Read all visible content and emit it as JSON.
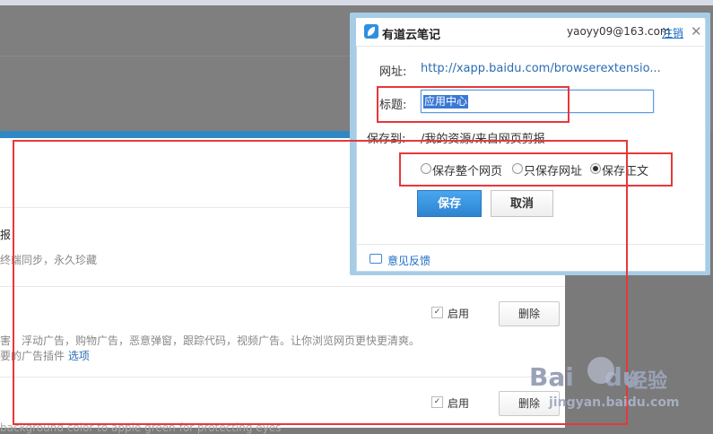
{
  "background_page": {
    "item1": {
      "title_fragment": "报",
      "desc_fragment": "终端同步，永久珍藏"
    },
    "item2": {
      "desc_line1": "害：浮动广告，购物广告，恶意弹窗，跟踪代码，视频广告。让你浏览网页更快更清爽。",
      "desc_line2": "要的广告插件",
      "options_link": "选项",
      "enable_label": "启用",
      "delete_label": "删除"
    },
    "item3": {
      "desc_fragment": "background color to apple green for protecting eyes",
      "enable_label": "启用",
      "delete_label": "删除"
    }
  },
  "popup": {
    "brand": "有道云笔记",
    "account": "yaoyy09@163.com",
    "logout": "注销",
    "close_glyph": "✕",
    "url_label": "网址:",
    "url_value": "http://xapp.baidu.com/browserextensio...",
    "title_label": "标题:",
    "title_value": "应用中心",
    "saveto_label": "保存到:",
    "saveto_value": "/我的资源/来自网页剪报",
    "radio_options": [
      "保存整个网页",
      "只保存网址",
      "保存正文"
    ],
    "radio_selected": 2,
    "save_button": "保存",
    "cancel_button": "取消",
    "feedback": "意见反馈"
  },
  "watermark": {
    "logo_text_bai": "Bai",
    "logo_text_du": "du",
    "jingyan": "经验",
    "url": "jingyan.baidu.com"
  },
  "colors": {
    "accent_blue": "#2f88c4",
    "annotation_red": "#e8373a",
    "link_blue": "#1a6cc6"
  }
}
